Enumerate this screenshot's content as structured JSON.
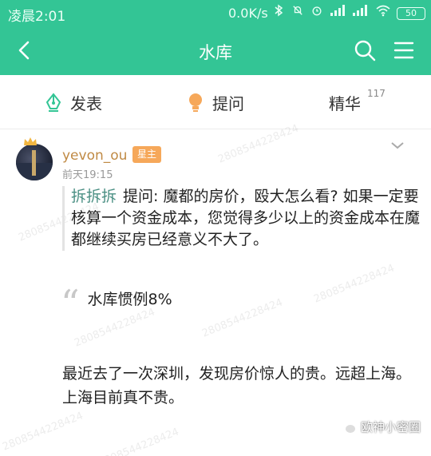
{
  "status_bar": {
    "time": "凌晨2:01",
    "network_speed": "0.0K/s",
    "battery": "50"
  },
  "app_bar": {
    "title": "水库"
  },
  "tabs": [
    {
      "label": "发表"
    },
    {
      "label": "提问"
    },
    {
      "label": "精华",
      "count": "117"
    }
  ],
  "post": {
    "author": "yevon_ou",
    "badge": "星主",
    "time": "前天19:15",
    "question_author": "拆拆拆",
    "question_text": "提问: 魔都的房价，殴大怎么看? 如果一定要核算一个资金成本，您觉得多少以上的资金成本在魔都继续买房已经意义不大了。",
    "answer": "水库惯例8%",
    "body_line1": "最近去了一次深圳，发现房价惊人的贵。远超上海。",
    "body_line2": "上海目前真不贵。"
  },
  "watermark": "2808544228424",
  "wechat_label": "欧神小密圈",
  "colors": {
    "accent": "#33c595",
    "username": "#c08a44",
    "badge": "#f6a85a",
    "question_author": "#4a8f83"
  },
  "icons": [
    "back-arrow-icon",
    "search-icon",
    "menu-icon",
    "pen-icon",
    "bulb-icon",
    "chevron-down-icon",
    "crown-icon",
    "quote-icon",
    "wechat-icon"
  ]
}
